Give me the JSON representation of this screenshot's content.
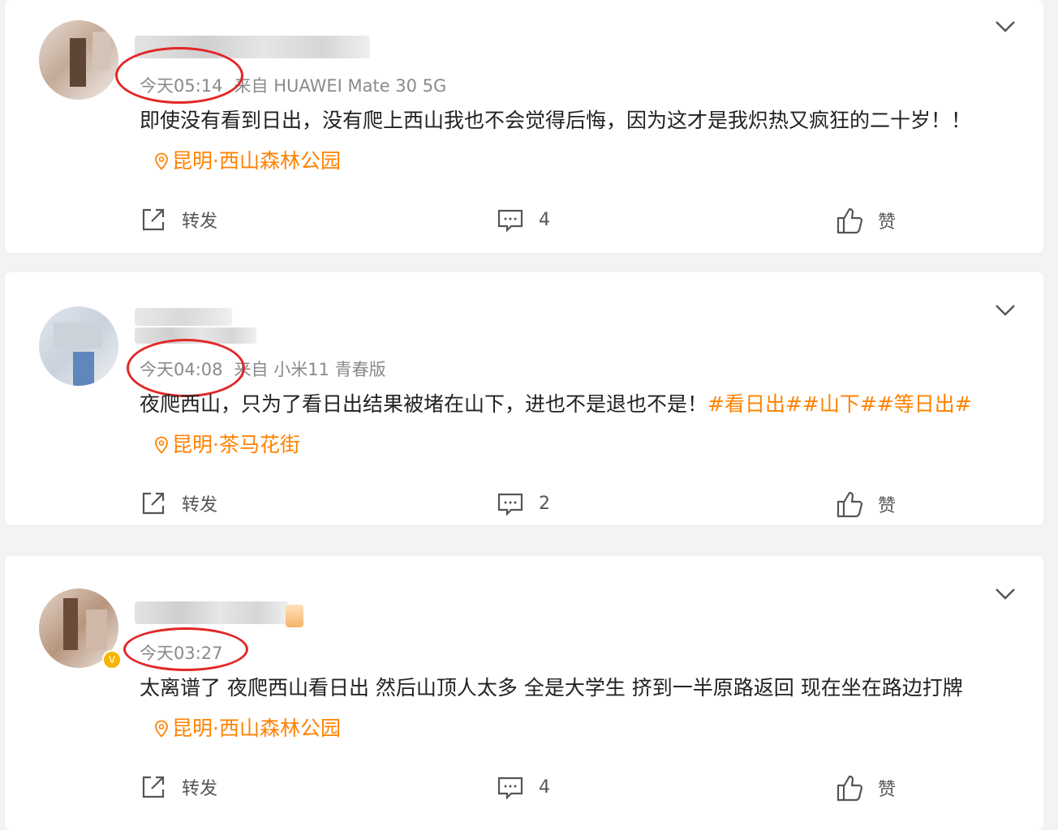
{
  "posts": [
    {
      "time": "今天05:14",
      "source": "来自 HUAWEI Mate 30 5G",
      "text": "即使没有看到日出，没有爬上西山我也不会觉得后悔，因为这才是我炽热又疯狂的二十岁！！",
      "hashtags": "",
      "location": "昆明·西山森林公园",
      "repost_label": "转发",
      "comment_count": "4",
      "like_label": "赞"
    },
    {
      "time": "今天04:08",
      "source": "来自 小米11 青春版",
      "text": "夜爬西山，只为了看日出结果被堵在山下，进也不是退也不是！",
      "hashtags": "#看日出##山下##等日出#",
      "location": "昆明·茶马花街",
      "repost_label": "转发",
      "comment_count": "2",
      "like_label": "赞"
    },
    {
      "time": "今天03:27",
      "source": "",
      "text": "太离谱了 夜爬西山看日出 然后山顶人太多 全是大学生 挤到一半原路返回 现在坐在路边打牌",
      "hashtags": "",
      "location": "昆明·西山森林公园",
      "repost_label": "转发",
      "comment_count": "4",
      "like_label": "赞"
    }
  ],
  "colors": {
    "accent_orange": "#ff8200",
    "annotation_red": "#e32626",
    "meta_gray": "#8a8a8a",
    "card_bg": "#ffffff",
    "page_bg": "#f2f3f5"
  },
  "icons": {
    "avatar": "avatar-blurred",
    "location": "location-pin-icon",
    "repost": "share-icon",
    "comment": "comment-icon",
    "like": "thumbs-up-icon",
    "menu": "chevron-down-icon",
    "verified": "verified-badge-icon"
  },
  "verified_badge": "V"
}
